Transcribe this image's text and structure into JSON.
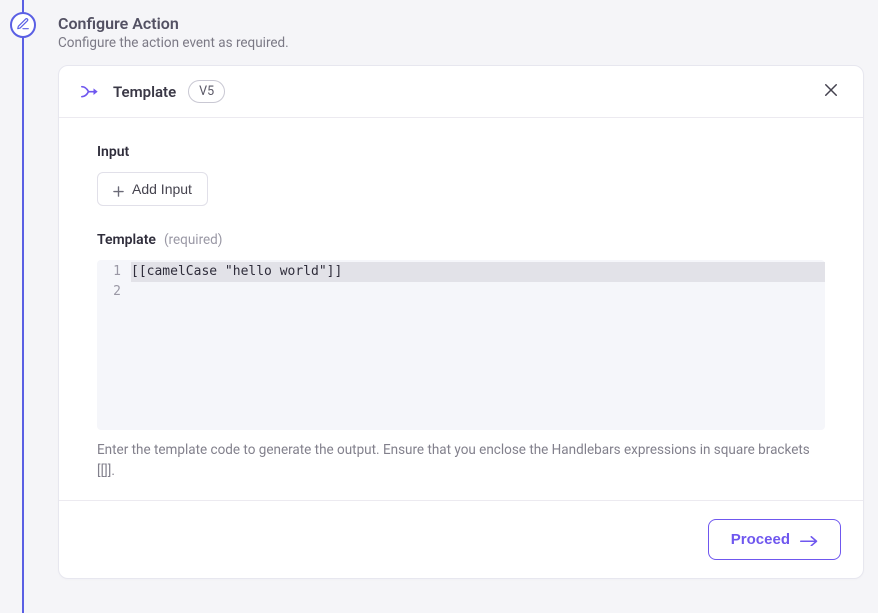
{
  "section": {
    "title": "Configure Action",
    "subtitle": "Configure the action event as required."
  },
  "card": {
    "header": {
      "title": "Template",
      "version": "V5"
    },
    "input": {
      "label": "Input",
      "add_button": "Add Input"
    },
    "template": {
      "label": "Template",
      "required": "(required)",
      "lines": {
        "l1_num": "1",
        "l1_code": "[[camelCase \"hello world\"]]",
        "l2_num": "2",
        "l2_code": ""
      },
      "helper": "Enter the template code to generate the output. Ensure that you enclose the Handlebars expressions in square brackets [[]]."
    },
    "footer": {
      "proceed": "Proceed"
    }
  }
}
